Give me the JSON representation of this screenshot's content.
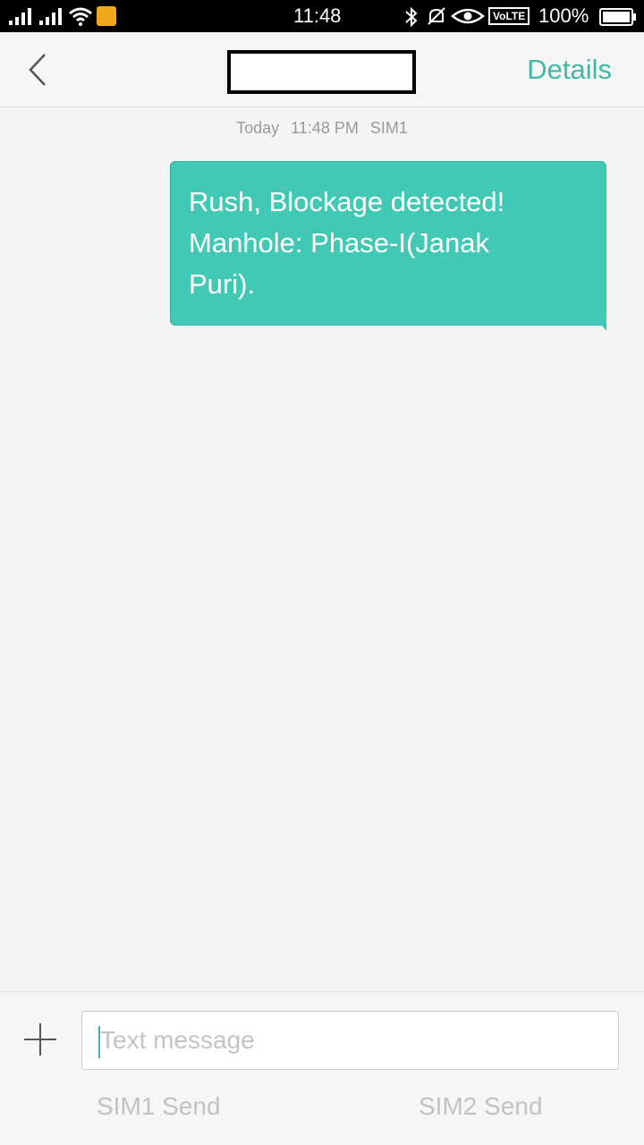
{
  "status_bar": {
    "time": "11:48",
    "battery_percent": "100%",
    "network_badge": "VoLTE",
    "icons": [
      "signal-icon",
      "signal-icon",
      "wifi-icon",
      "notification-icon",
      "bluetooth-icon",
      "mute-icon",
      "eye-icon",
      "battery-icon"
    ]
  },
  "header": {
    "back_icon": "chevron-left-icon",
    "details_label": "Details"
  },
  "conversation": {
    "timestamp": {
      "day": "Today",
      "time": "11:48 PM",
      "sim": "SIM1"
    },
    "messages": [
      {
        "lines": [
          "Rush, Blockage detected!",
          "Manhole: Phase-I(Janak",
          "Puri)."
        ]
      }
    ]
  },
  "composer": {
    "add_icon": "plus-icon",
    "placeholder": "Text message",
    "value": "",
    "sim1_send_label": "SIM1 Send",
    "sim2_send_label": "SIM2 Send"
  },
  "colors": {
    "accent": "#41b8a8",
    "bubble": "#42c9b6",
    "background": "#f4f4f4",
    "status_bar": "#000000"
  }
}
